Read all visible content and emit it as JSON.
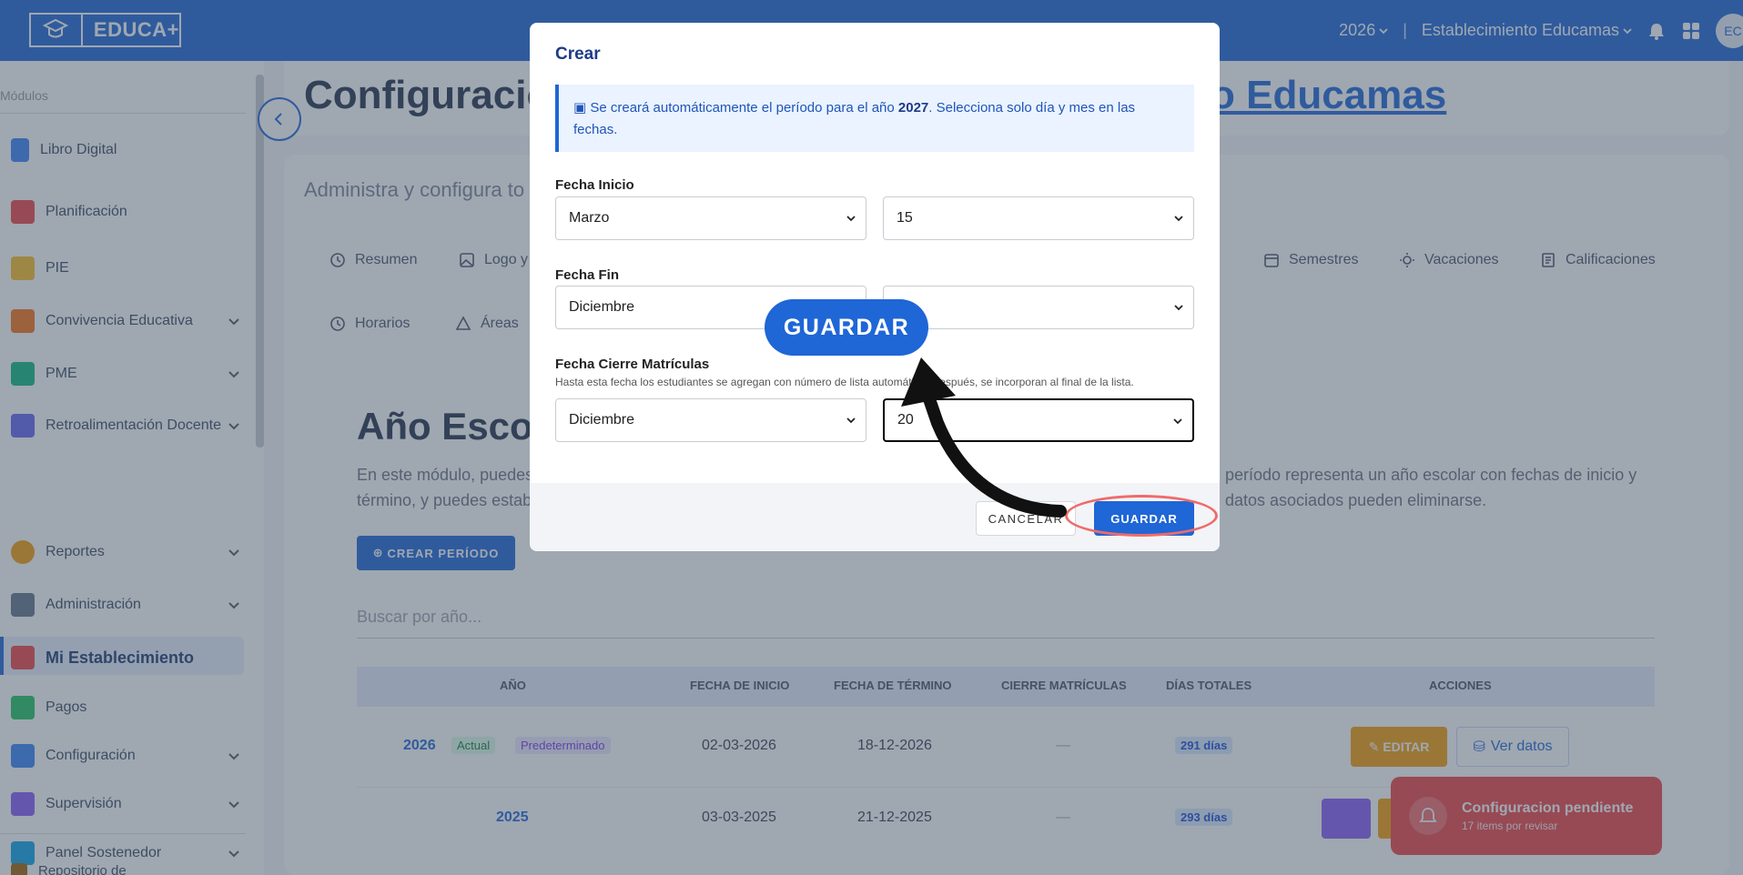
{
  "header": {
    "logo_text": "EDUCA+",
    "year": "2026",
    "school": "Establecimiento Educamas",
    "avatar_initials": "EC"
  },
  "sidebar": {
    "heading": "Módulos",
    "items": [
      {
        "label": "Libro Digital",
        "has_chevron": false
      },
      {
        "label": "Planificación",
        "has_chevron": false
      },
      {
        "label": "PIE",
        "has_chevron": false
      },
      {
        "label": "Convivencia Educativa",
        "has_chevron": true
      },
      {
        "label": "PME",
        "has_chevron": true
      },
      {
        "label": "Retroalimentación Docente",
        "has_chevron": true
      },
      {
        "label": "Reportes",
        "has_chevron": true
      },
      {
        "label": "Administración",
        "has_chevron": true
      },
      {
        "label": "Mi Establecimiento",
        "has_chevron": false,
        "active": true
      },
      {
        "label": "Pagos",
        "has_chevron": false
      },
      {
        "label": "Configuración",
        "has_chevron": true
      },
      {
        "label": "Supervisión",
        "has_chevron": true
      },
      {
        "label": "Panel Sostenedor",
        "has_chevron": true
      },
      {
        "label": "Repositorio de",
        "has_chevron": false
      }
    ]
  },
  "main": {
    "title_left": "Configuració",
    "title_right": "o Educamas",
    "subtitle": "Administra y configura to",
    "tabs": [
      "Resumen",
      "Logo y",
      "Semestres",
      "Vacaciones",
      "Calificaciones",
      "Horarios",
      "Áreas"
    ],
    "section_title": "Año Escol",
    "desc_left_1": "En este módulo, puedes",
    "desc_left_2": "término, y puedes estab",
    "desc_right_1": "período representa un año escolar con fechas de inicio y",
    "desc_right_2": "datos asociados pueden eliminarse.",
    "create_button": "CREAR PERÍODO",
    "search_placeholder": "Buscar por año...",
    "table": {
      "headers": [
        "AÑO",
        "FECHA DE INICIO",
        "FECHA DE TÉRMINO",
        "CIERRE MATRÍCULAS",
        "DÍAS TOTALES",
        "ACCIONES"
      ],
      "rows": [
        {
          "year": "2026",
          "badge_current": "Actual",
          "badge_default": "Predeterminado",
          "start": "02-03-2026",
          "end": "18-12-2026",
          "closing": "—",
          "days": "291 días",
          "edit": "EDITAR",
          "view": "Ver datos"
        },
        {
          "year": "2025",
          "start": "03-03-2025",
          "end": "21-12-2025",
          "closing": "—",
          "days": "293 días"
        }
      ]
    },
    "toast": {
      "title": "Configuracion pendiente",
      "subtitle": "17 items por revisar"
    }
  },
  "modal": {
    "title": "Crear",
    "info_prefix": "Se creará automáticamente el período para el año ",
    "info_year": "2027",
    "info_suffix": ". Selecciona solo día y mes en las fechas.",
    "start_label": "Fecha Inicio",
    "start_month": "Marzo",
    "start_day": "15",
    "end_label": "Fecha Fin",
    "end_month": "Diciembre",
    "end_day": "",
    "closing_label": "Fecha Cierre Matrículas",
    "closing_hint": "Hasta esta fecha los estudiantes se agregan con número de lista automático. Después, se incorporan al final de la lista.",
    "closing_month": "Diciembre",
    "closing_day": "20",
    "cancel": "CANCELAR",
    "save": "GUARDAR"
  },
  "callout": {
    "text": "GUARDAR"
  },
  "colors": {
    "primary": "#1f66d6",
    "warning": "#f59e0b",
    "danger": "#ef4444",
    "purple": "#8b5cf6"
  }
}
